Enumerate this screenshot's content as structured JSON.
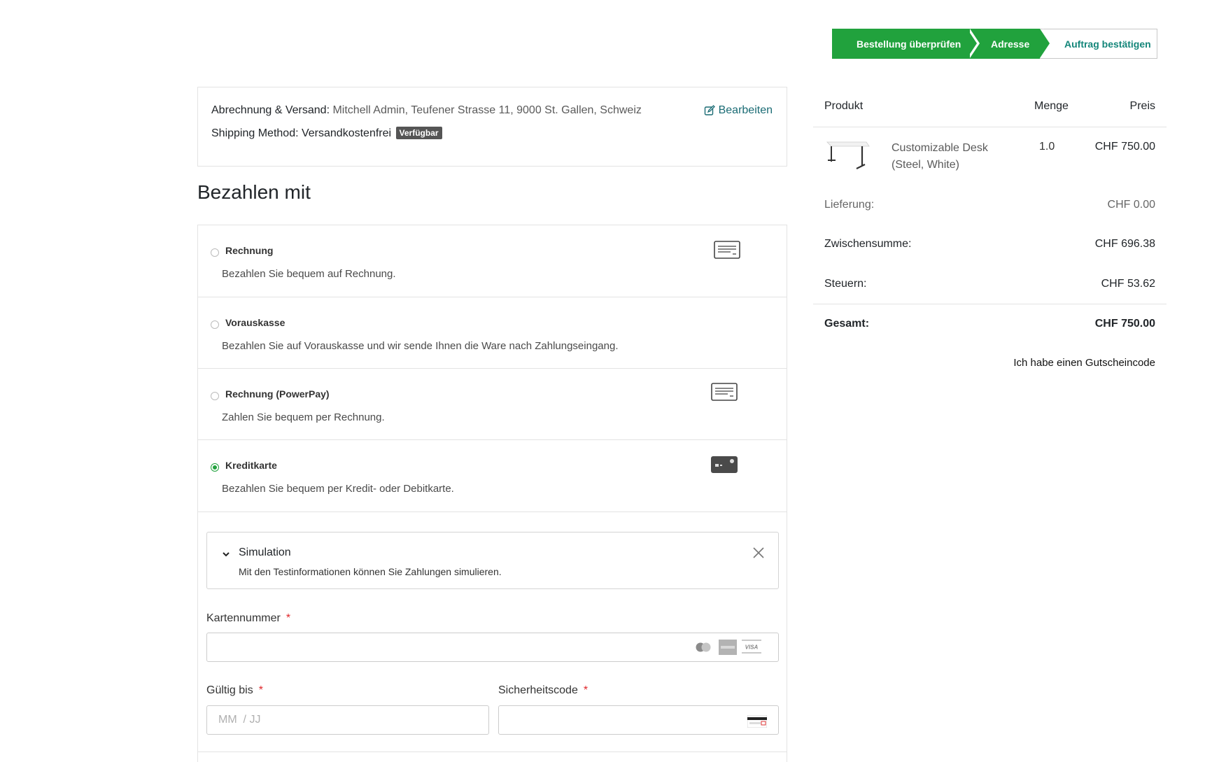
{
  "steps": [
    {
      "label": "Bestellung überprüfen"
    },
    {
      "label": "Adresse"
    },
    {
      "label": "Auftrag bestätigen"
    }
  ],
  "address": {
    "billing_label": "Abrechnung & Versand:",
    "billing_value": "Mitchell Admin, Teufener Strasse 11, 9000 St. Gallen, Schweiz",
    "shipping_label": "Shipping Method:",
    "shipping_value": "Versandkostenfrei",
    "badge": "Verfügbar",
    "edit_label": "Bearbeiten"
  },
  "payment": {
    "title": "Bezahlen mit",
    "options": [
      {
        "name": "Rechnung",
        "desc": "Bezahlen Sie bequem auf Rechnung.",
        "icon": "invoice-icon",
        "selected": false
      },
      {
        "name": "Vorauskasse",
        "desc": "Bezahlen Sie auf Vorauskasse und wir sende Ihnen die Ware nach Zahlungseingang.",
        "icon": "",
        "selected": false
      },
      {
        "name": "Rechnung (PowerPay)",
        "desc": "Zahlen Sie bequem per Rechnung.",
        "icon": "invoice-icon",
        "selected": false
      },
      {
        "name": "Kreditkarte",
        "desc": "Bezahlen Sie bequem per Kredit- oder Debitkarte.",
        "icon": "credit-card-icon",
        "selected": true
      }
    ],
    "simulation": {
      "title": "Simulation",
      "desc": "Mit den Testinformationen können Sie Zahlungen simulieren."
    },
    "card_number": {
      "label": "Kartennummer",
      "required": "*",
      "value": ""
    },
    "expiry": {
      "label": "Gültig bis",
      "required": "*",
      "placeholder": "MM  / JJ"
    },
    "cvc": {
      "label": "Sicherheitscode",
      "required": "*",
      "value": ""
    }
  },
  "summary": {
    "headers": {
      "product": "Produkt",
      "qty": "Menge",
      "price": "Preis"
    },
    "product": {
      "name": "Customizable Desk (Steel, White)",
      "qty": "1.0",
      "price": "CHF 750.00"
    },
    "delivery_label": "Lieferung:",
    "delivery_value": "CHF 0.00",
    "subtotal_label": "Zwischensumme:",
    "subtotal_value": "CHF 696.38",
    "tax_label": "Steuern:",
    "tax_value": "CHF 53.62",
    "total_label": "Gesamt:",
    "total_value": "CHF 750.00",
    "coupon": "Ich habe einen Gutscheincode"
  },
  "colors": {
    "accent": "#21a23d",
    "link": "#1a6b74",
    "required": "#e0272b"
  }
}
